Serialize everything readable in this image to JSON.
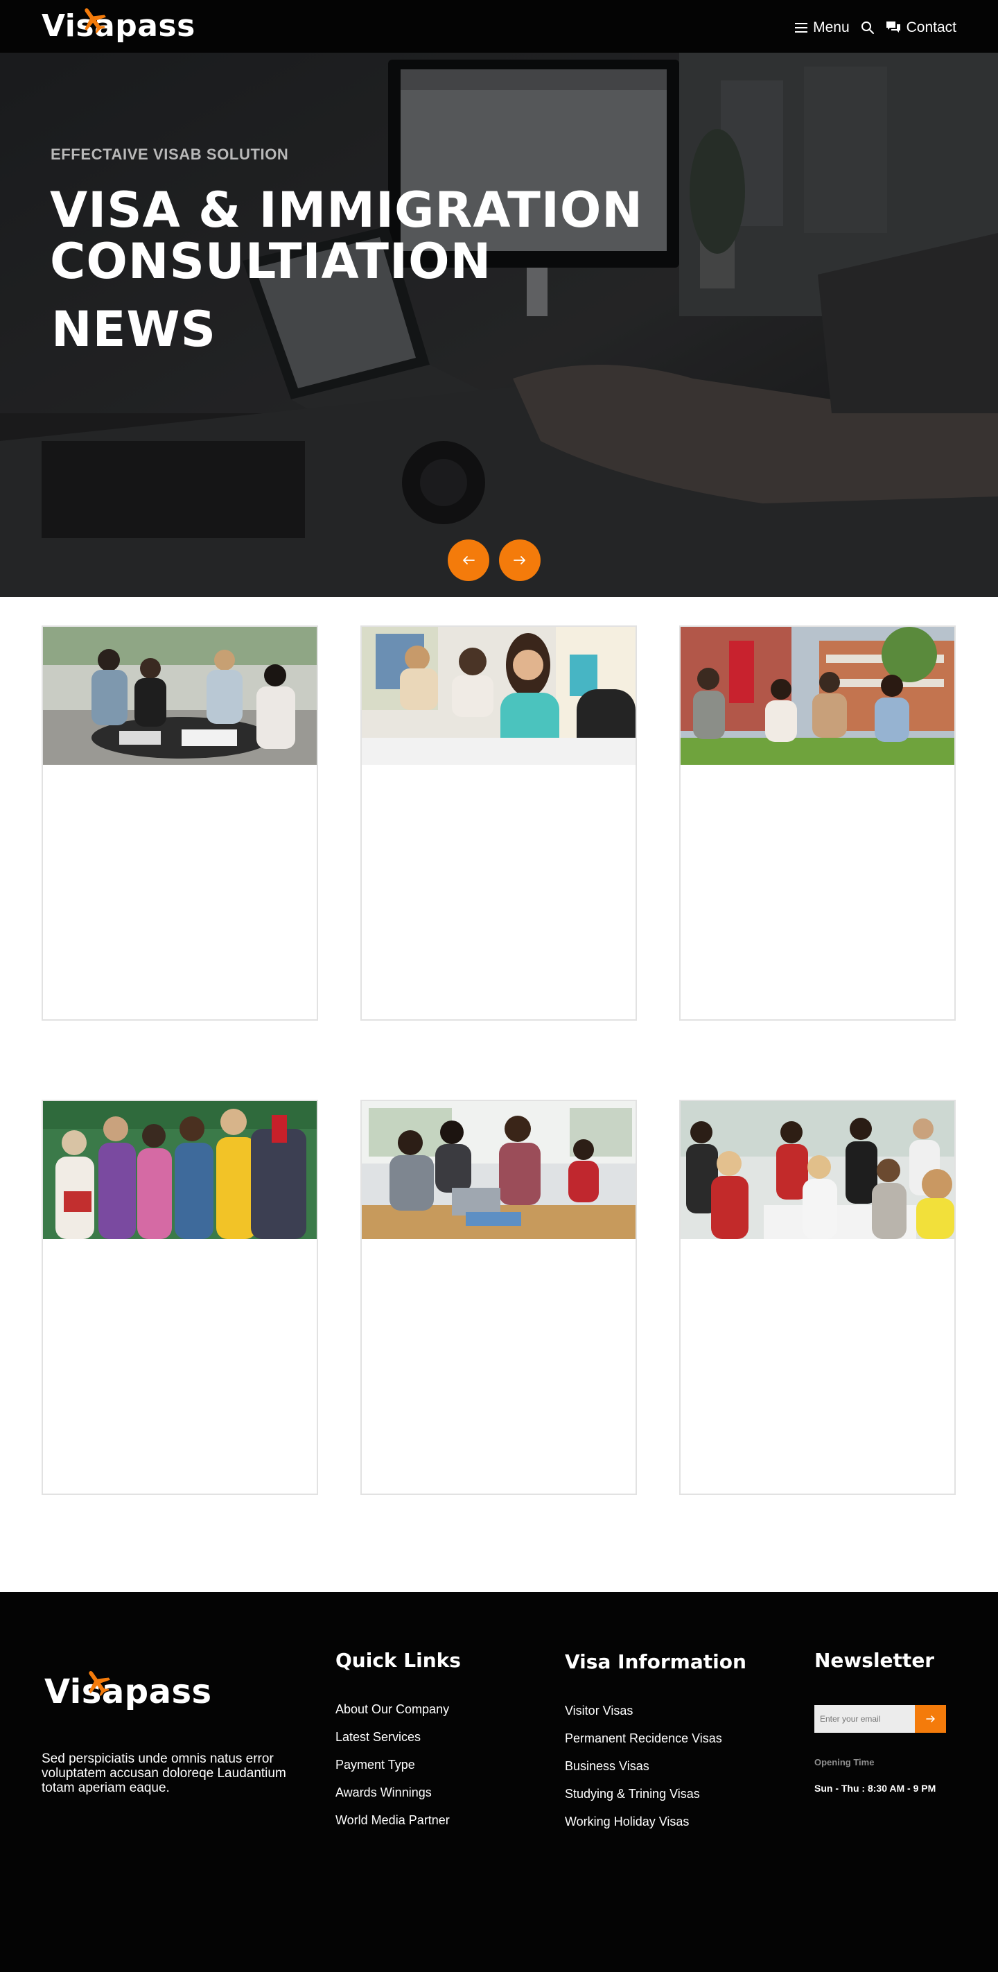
{
  "brand": {
    "name": "Visapass",
    "accent": "#f47b0b"
  },
  "header": {
    "menu_label": "Menu",
    "contact_label": "Contact"
  },
  "hero": {
    "subtitle": "EFFECTAIVE VISAB SOLUTION",
    "title_line1": "VISA & IMMIGRATION",
    "title_line2": "CONSULTIATION",
    "title_line3": "NEWS"
  },
  "cards": [
    {
      "image": "students-at-table-photo"
    },
    {
      "image": "student-in-class-photo"
    },
    {
      "image": "students-on-lawn-photo"
    },
    {
      "image": "students-group-photo"
    },
    {
      "image": "students-with-laptop-photo"
    },
    {
      "image": "students-study-group-photo"
    }
  ],
  "footer": {
    "about": "Sed perspiciatis unde omnis natus error voluptatem accusan doloreqe Laudantium totam aperiam eaque.",
    "quick_links": {
      "title": "Quick Links",
      "items": [
        "About Our Company",
        "Latest Services",
        "Payment Type",
        "Awards Winnings",
        "World Media Partner"
      ]
    },
    "visa_info": {
      "title": "Visa Information",
      "items": [
        "Visitor Visas",
        "Permanent Recidence Visas",
        "Business Visas",
        "Studying & Trining Visas",
        "Working Holiday Visas"
      ]
    },
    "newsletter": {
      "title": "Newsletter",
      "placeholder": "Enter your email",
      "opening_label": "Opening Time",
      "opening_value": "Sun - Thu : 8:30 AM - 9 PM"
    }
  }
}
